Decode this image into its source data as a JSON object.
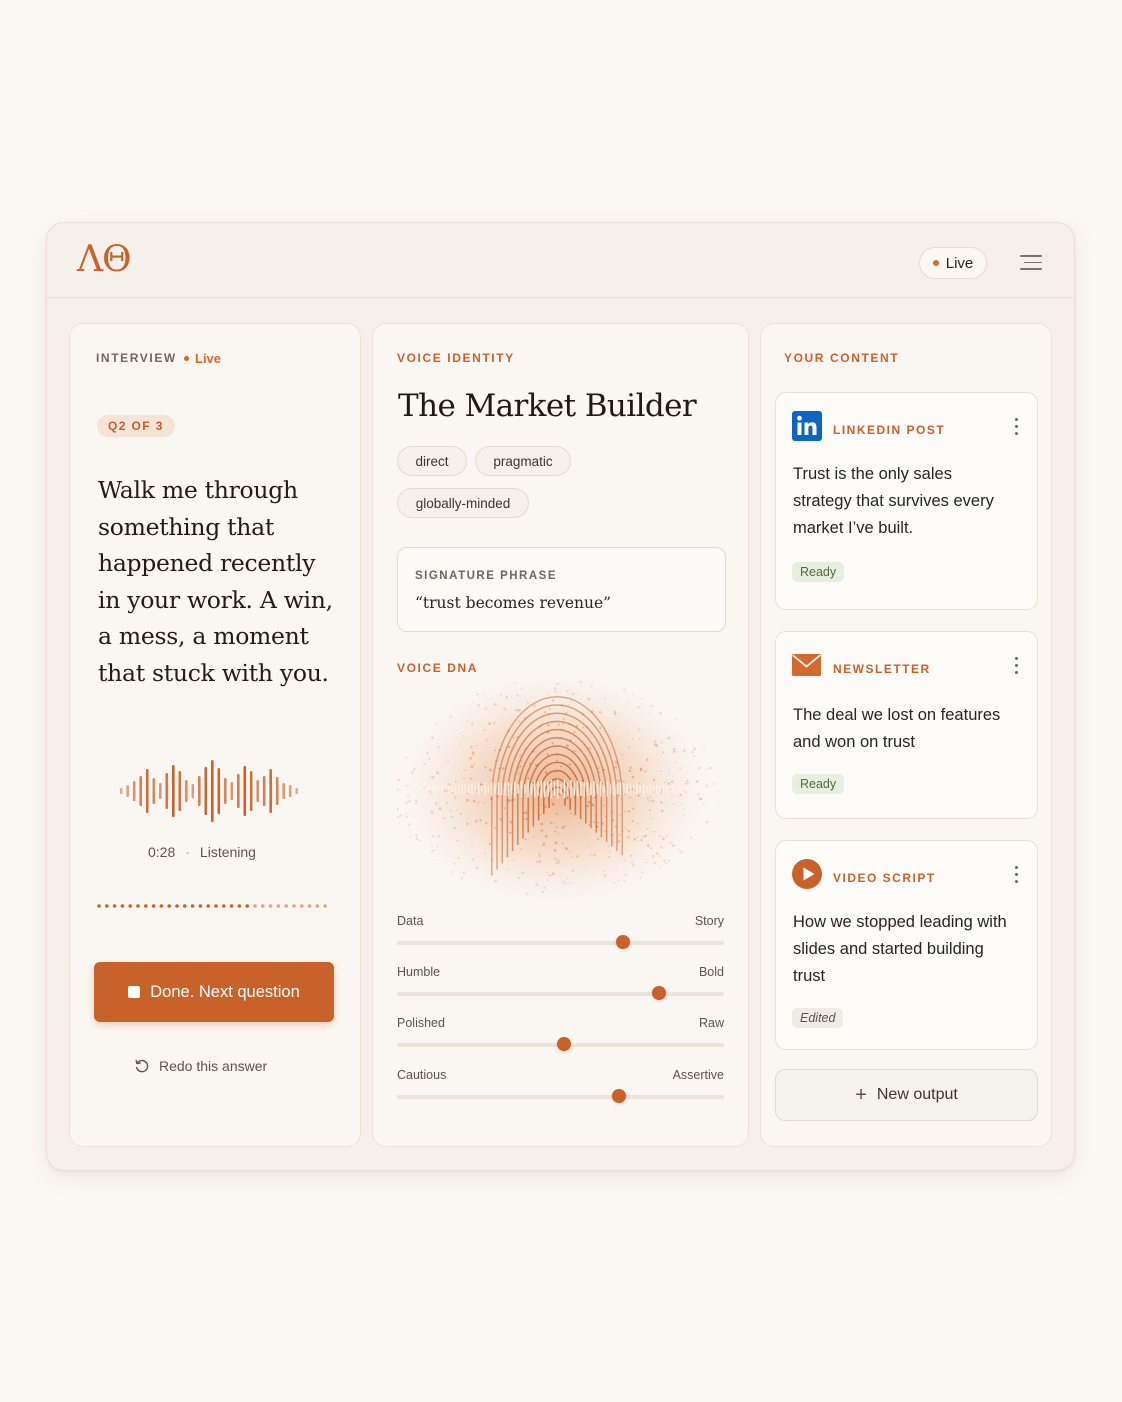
{
  "header": {
    "logo": "ΛΘ",
    "live_label": "Live",
    "accent_color": "#c8622a"
  },
  "interview": {
    "section_label": "INTERVIEW",
    "live_label": "Live",
    "question_badge": "Q2 OF 3",
    "question_text": "Walk me through something that happened recently in your work. A win, a mess, a moment that stuck with you.",
    "timer": "0:28",
    "separator": "·",
    "status": "Listening",
    "primary_button": "Done. Next question",
    "redo_label": "Redo this answer"
  },
  "voice_identity": {
    "section_label": "VOICE IDENTITY",
    "persona_name": "The Market Builder",
    "tags": [
      "direct",
      "pragmatic",
      "globally-minded"
    ],
    "signature_label": "SIGNATURE PHRASE",
    "signature_phrase": "“trust becomes revenue”",
    "dna_label": "VOICE DNA",
    "sliders": [
      {
        "left": "Data",
        "right": "Story",
        "value": 0.69
      },
      {
        "left": "Humble",
        "right": "Bold",
        "value": 0.8
      },
      {
        "left": "Polished",
        "right": "Raw",
        "value": 0.51
      },
      {
        "left": "Cautious",
        "right": "Assertive",
        "value": 0.68
      }
    ]
  },
  "content": {
    "section_label": "YOUR CONTENT",
    "items": [
      {
        "type": "LINKEDIN POST",
        "icon": "linkedin-icon",
        "text": "Trust is the only sales strategy that survives every market I’ve built.",
        "status": "Ready"
      },
      {
        "type": "NEWSLETTER",
        "icon": "mail-icon",
        "text": "The deal we lost on features and won on trust",
        "status": "Ready"
      },
      {
        "type": "VIDEO SCRIPT",
        "icon": "play-icon",
        "text": "How we stopped leading with slides and started building trust",
        "status": "Edited"
      }
    ],
    "new_output_label": "New output"
  }
}
